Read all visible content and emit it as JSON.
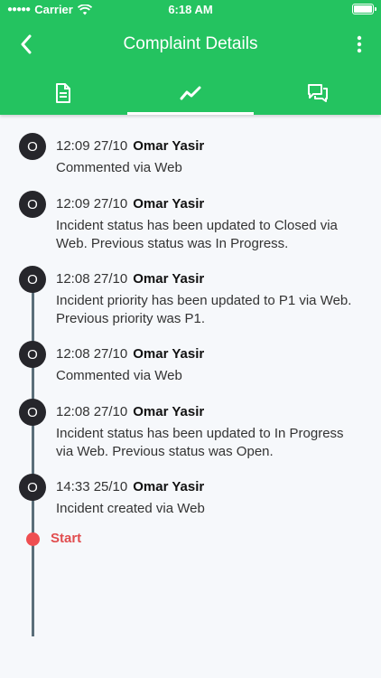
{
  "status_bar": {
    "carrier": "Carrier",
    "time": "6:18 AM"
  },
  "nav": {
    "title": "Complaint Details",
    "back_icon": "chevron-left-icon",
    "more_icon": "more-vertical-icon"
  },
  "tabs": [
    {
      "icon": "document-icon",
      "active": false
    },
    {
      "icon": "trend-line-icon",
      "active": true
    },
    {
      "icon": "chat-icon",
      "active": false
    }
  ],
  "timeline": [
    {
      "badge": "O",
      "time": "12:09 27/10",
      "name": "Omar Yasir",
      "text": "Commented via Web"
    },
    {
      "badge": "O",
      "time": "12:09 27/10",
      "name": "Omar Yasir",
      "text": "Incident status has been updated to Closed via Web. Previous status was In Progress."
    },
    {
      "badge": "O",
      "time": "12:08 27/10",
      "name": "Omar Yasir",
      "text": "Incident priority has been updated to P1 via Web. Previous priority was P1."
    },
    {
      "badge": "O",
      "time": "12:08 27/10",
      "name": "Omar Yasir",
      "text": "Commented via Web"
    },
    {
      "badge": "O",
      "time": "12:08 27/10",
      "name": "Omar Yasir",
      "text": "Incident status has been updated to In Progress via Web. Previous status was Open."
    },
    {
      "badge": "O",
      "time": "14:33 25/10",
      "name": "Omar Yasir",
      "text": "Incident created via Web"
    }
  ],
  "start_label": "Start",
  "colors": {
    "header": "#24c360",
    "badge": "#26262b",
    "start": "#ef4e51"
  }
}
